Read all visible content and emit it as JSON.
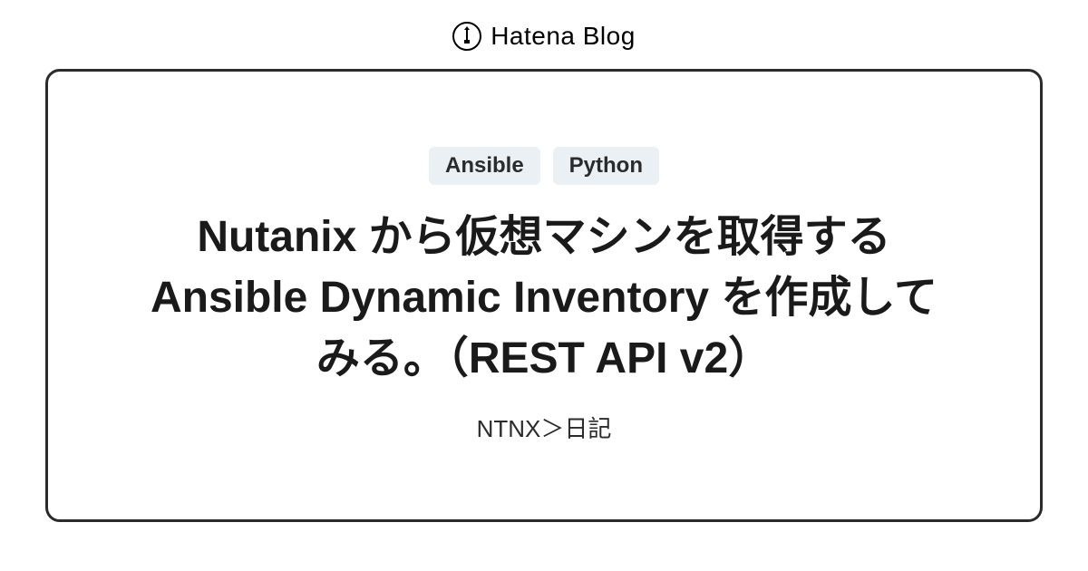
{
  "header": {
    "brand": "Hatena Blog"
  },
  "card": {
    "tags": [
      "Ansible",
      "Python"
    ],
    "title": "Nutanix から仮想マシンを取得する Ansible Dynamic Inventory を作成してみる。（REST API v2）",
    "blog_name": "NTNX＞日記"
  }
}
